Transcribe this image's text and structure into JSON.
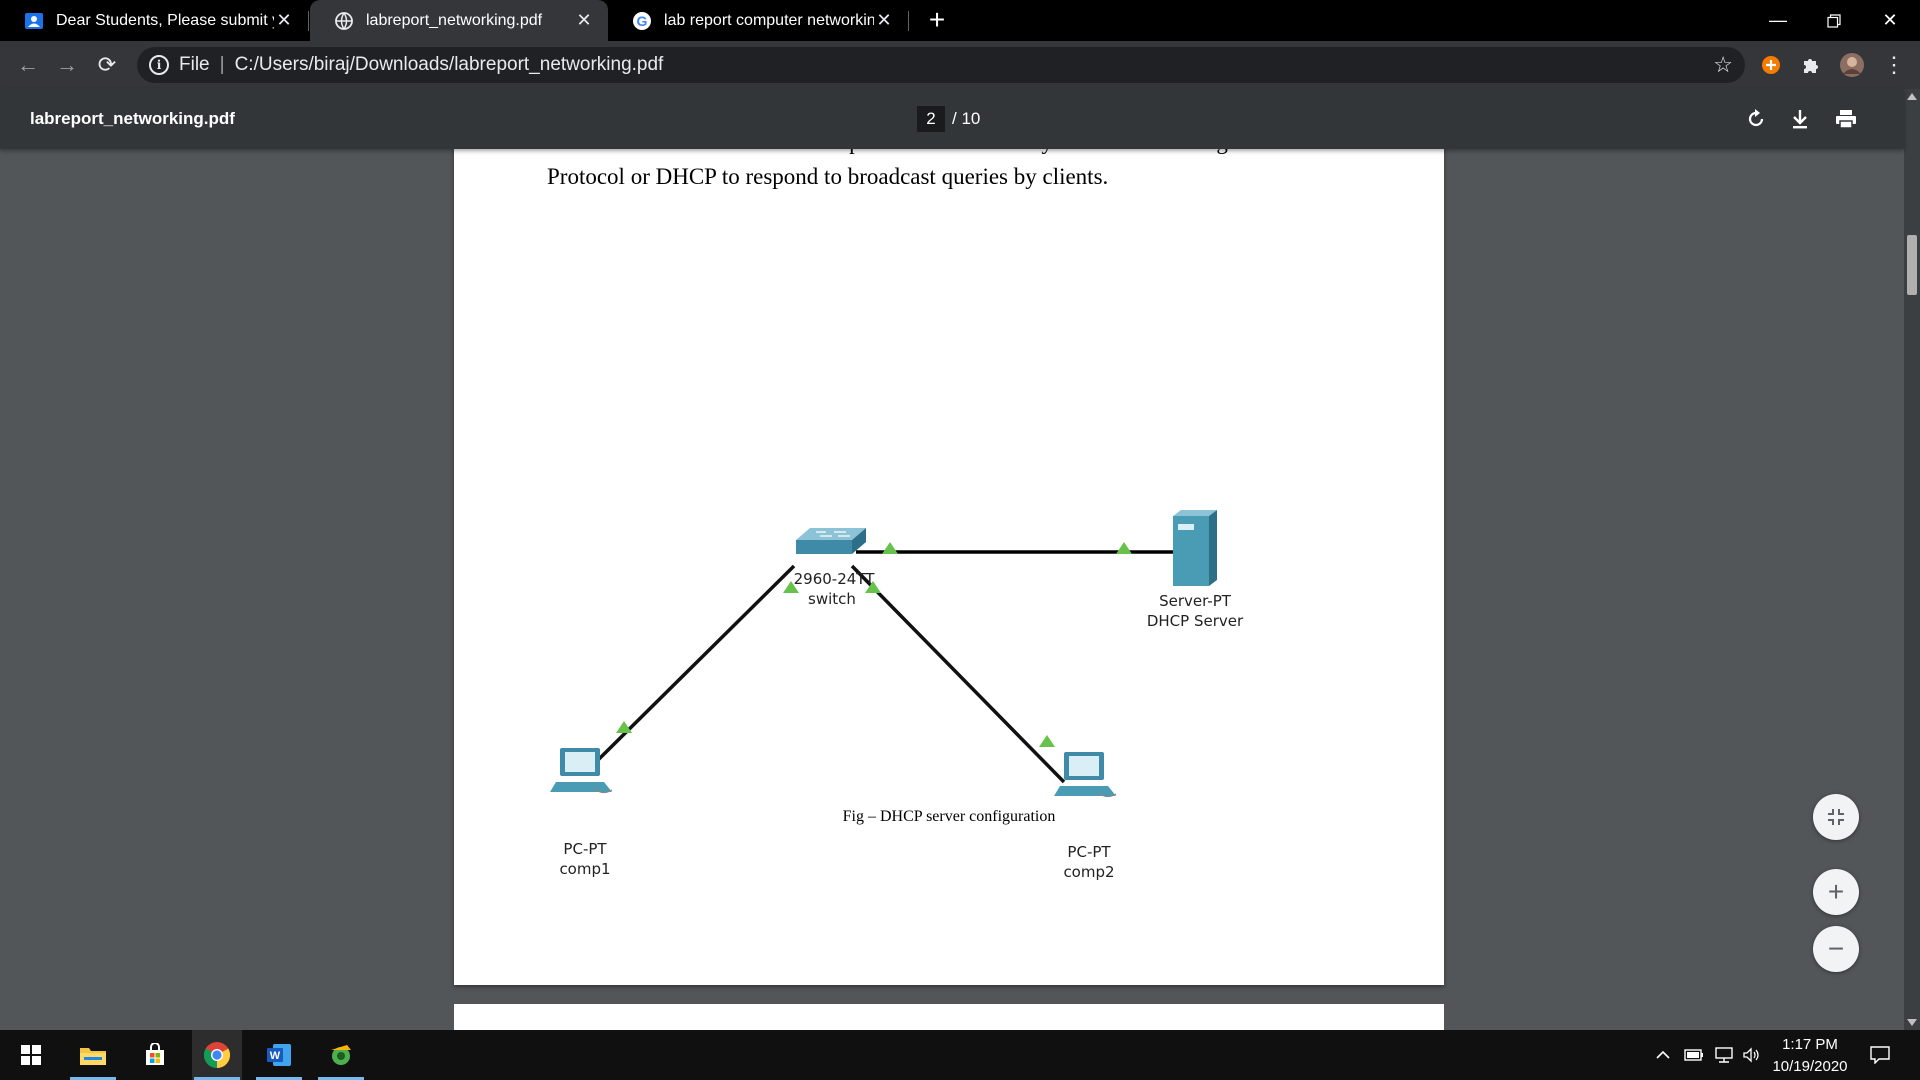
{
  "tabs": [
    {
      "title": "Dear Students, Please submit you",
      "icon": "classroom-icon"
    },
    {
      "title": "labreport_networking.pdf",
      "icon": "globe-icon"
    },
    {
      "title": "lab report computer networking",
      "icon": "google-icon"
    }
  ],
  "address": {
    "scheme_label": "File",
    "url": "C:/Users/biraj/Downloads/labreport_networking.pdf"
  },
  "pdf": {
    "title": "labreport_networking.pdf",
    "current_page": "2",
    "total_pages": "/ 10"
  },
  "document": {
    "partial_line": "devices. It relies on the standard protocol known as Dynamic Host Configuration",
    "line": "Protocol or DHCP to respond to broadcast queries by clients.",
    "caption": "Fig – DHCP server configuration"
  },
  "diagram": {
    "switch": {
      "model": "2960-24TT",
      "name": "switch"
    },
    "server": {
      "model": "Server-PT",
      "name": "DHCP Server"
    },
    "pc1": {
      "model": "PC-PT",
      "name": "comp1"
    },
    "pc2": {
      "model": "PC-PT",
      "name": "comp2"
    },
    "link_color": "#000000",
    "port_color": "#66c24a",
    "device_color": "#4a9bb4"
  },
  "taskbar": {
    "time": "1:17 PM",
    "date": "10/19/2020",
    "apps": [
      "windows-start-icon",
      "file-explorer-icon",
      "store-icon",
      "chrome-icon",
      "word-icon",
      "app-icon"
    ]
  },
  "colors": {
    "chrome_dark": "#35363a",
    "pdf_toolbar": "#323639",
    "viewer_bg": "#525659"
  }
}
